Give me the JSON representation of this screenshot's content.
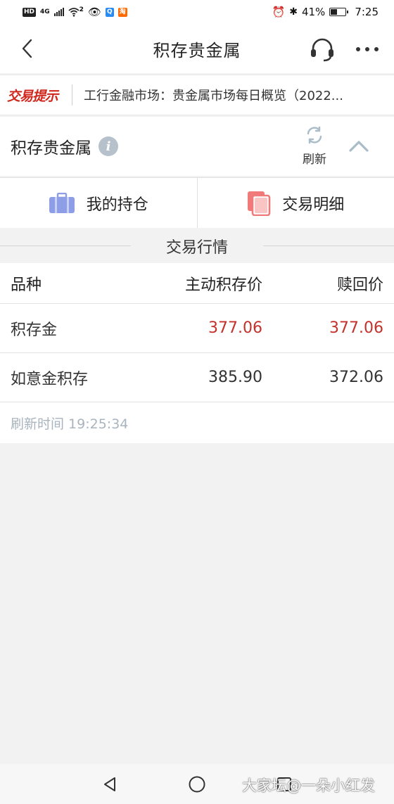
{
  "status_bar": {
    "hd": "HD",
    "network": "4G",
    "wifi_level": "2",
    "app_badge": "淘",
    "battery": "41%",
    "time": "7:25"
  },
  "header": {
    "title": "积存贵金属"
  },
  "notice": {
    "tag": "交易提示",
    "text": "工行金融市场：贵金属市场每日概览（2022..."
  },
  "section": {
    "title": "积存贵金属",
    "info_symbol": "i",
    "refresh_label": "刷新"
  },
  "quick_actions": [
    {
      "label": "我的持仓",
      "icon": "briefcase-icon",
      "color": "#8e9ee6"
    },
    {
      "label": "交易明细",
      "icon": "documents-icon",
      "color": "#f07a7a"
    }
  ],
  "market": {
    "title": "交易行情",
    "columns": [
      "品种",
      "主动积存价",
      "赎回价"
    ],
    "rows": [
      {
        "name": "积存金",
        "buy": "377.06",
        "sell": "377.06",
        "highlight": true
      },
      {
        "name": "如意金积存",
        "buy": "385.90",
        "sell": "372.06",
        "highlight": false
      }
    ],
    "refresh_time": "刷新时间 19:25:34"
  },
  "watermark": "大家坛@一朵小红发",
  "colors": {
    "accent_red": "#c4312a",
    "notice_red": "#d0271d",
    "muted": "#a9b4bf"
  }
}
